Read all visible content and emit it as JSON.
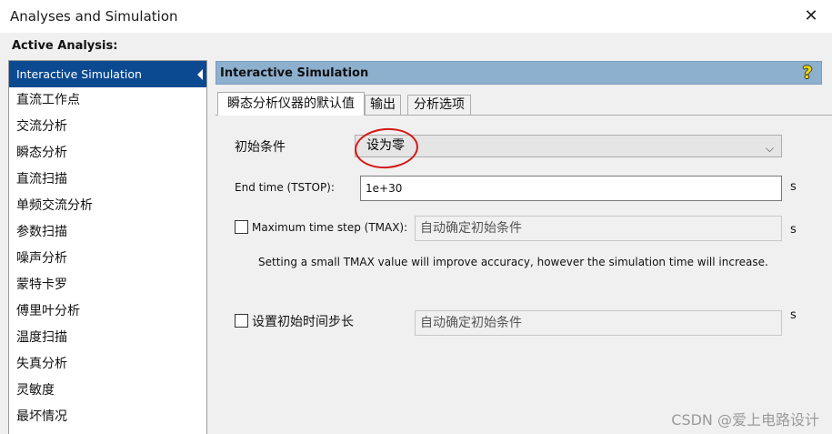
{
  "window": {
    "title": "Analyses and Simulation",
    "close_glyph": "✕"
  },
  "sidebar": {
    "heading": "Active Analysis:",
    "items": [
      {
        "label": "Interactive Simulation"
      },
      {
        "label": "直流工作点"
      },
      {
        "label": "交流分析"
      },
      {
        "label": "瞬态分析"
      },
      {
        "label": "直流扫描"
      },
      {
        "label": "单频交流分析"
      },
      {
        "label": "参数扫描"
      },
      {
        "label": "噪声分析"
      },
      {
        "label": "蒙特卡罗"
      },
      {
        "label": "傅里叶分析"
      },
      {
        "label": "温度扫描"
      },
      {
        "label": "失真分析"
      },
      {
        "label": "灵敏度"
      },
      {
        "label": "最坏情况"
      }
    ]
  },
  "panel": {
    "title": "Interactive Simulation",
    "help_glyph": "?",
    "tabs": [
      {
        "label": "瞬态分析仪器的默认值"
      },
      {
        "label": "输出"
      },
      {
        "label": "分析选项"
      }
    ]
  },
  "form": {
    "initial_conditions": {
      "label": "初始条件",
      "value": "设为零",
      "arrow": "⌵"
    },
    "end_time": {
      "label": "End time (TSTOP):",
      "value": "1e+30",
      "unit": "s"
    },
    "max_time_step": {
      "label": "Maximum time step (TMAX):",
      "value": "自动确定初始条件",
      "unit": "s"
    },
    "hint": "Setting a small TMAX value will improve accuracy, however the simulation time will increase.",
    "initial_step": {
      "label": "设置初始时间步长",
      "value": "自动确定初始条件",
      "unit": "s"
    }
  },
  "watermark": "CSDN @爱上电路设计",
  "colors": {
    "selection": "#0b4a91",
    "panel_header": "#8eb0cf",
    "annotation_circle": "#d41818",
    "help_icon": "#f5d800"
  }
}
